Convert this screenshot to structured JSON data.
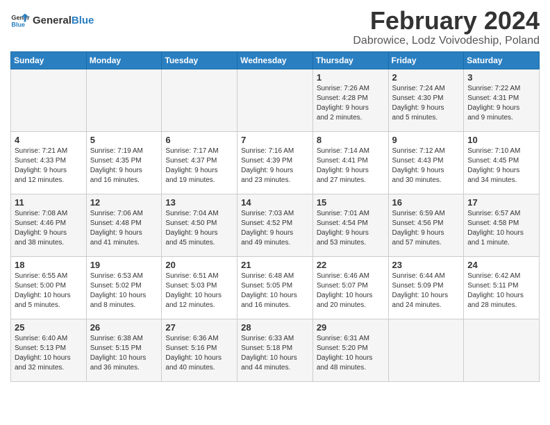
{
  "header": {
    "logo_general": "General",
    "logo_blue": "Blue",
    "title": "February 2024",
    "subtitle": "Dabrowice, Lodz Voivodeship, Poland"
  },
  "weekdays": [
    "Sunday",
    "Monday",
    "Tuesday",
    "Wednesday",
    "Thursday",
    "Friday",
    "Saturday"
  ],
  "weeks": [
    [
      {
        "day": "",
        "info": ""
      },
      {
        "day": "",
        "info": ""
      },
      {
        "day": "",
        "info": ""
      },
      {
        "day": "",
        "info": ""
      },
      {
        "day": "1",
        "info": "Sunrise: 7:26 AM\nSunset: 4:28 PM\nDaylight: 9 hours\nand 2 minutes."
      },
      {
        "day": "2",
        "info": "Sunrise: 7:24 AM\nSunset: 4:30 PM\nDaylight: 9 hours\nand 5 minutes."
      },
      {
        "day": "3",
        "info": "Sunrise: 7:22 AM\nSunset: 4:31 PM\nDaylight: 9 hours\nand 9 minutes."
      }
    ],
    [
      {
        "day": "4",
        "info": "Sunrise: 7:21 AM\nSunset: 4:33 PM\nDaylight: 9 hours\nand 12 minutes."
      },
      {
        "day": "5",
        "info": "Sunrise: 7:19 AM\nSunset: 4:35 PM\nDaylight: 9 hours\nand 16 minutes."
      },
      {
        "day": "6",
        "info": "Sunrise: 7:17 AM\nSunset: 4:37 PM\nDaylight: 9 hours\nand 19 minutes."
      },
      {
        "day": "7",
        "info": "Sunrise: 7:16 AM\nSunset: 4:39 PM\nDaylight: 9 hours\nand 23 minutes."
      },
      {
        "day": "8",
        "info": "Sunrise: 7:14 AM\nSunset: 4:41 PM\nDaylight: 9 hours\nand 27 minutes."
      },
      {
        "day": "9",
        "info": "Sunrise: 7:12 AM\nSunset: 4:43 PM\nDaylight: 9 hours\nand 30 minutes."
      },
      {
        "day": "10",
        "info": "Sunrise: 7:10 AM\nSunset: 4:45 PM\nDaylight: 9 hours\nand 34 minutes."
      }
    ],
    [
      {
        "day": "11",
        "info": "Sunrise: 7:08 AM\nSunset: 4:46 PM\nDaylight: 9 hours\nand 38 minutes."
      },
      {
        "day": "12",
        "info": "Sunrise: 7:06 AM\nSunset: 4:48 PM\nDaylight: 9 hours\nand 41 minutes."
      },
      {
        "day": "13",
        "info": "Sunrise: 7:04 AM\nSunset: 4:50 PM\nDaylight: 9 hours\nand 45 minutes."
      },
      {
        "day": "14",
        "info": "Sunrise: 7:03 AM\nSunset: 4:52 PM\nDaylight: 9 hours\nand 49 minutes."
      },
      {
        "day": "15",
        "info": "Sunrise: 7:01 AM\nSunset: 4:54 PM\nDaylight: 9 hours\nand 53 minutes."
      },
      {
        "day": "16",
        "info": "Sunrise: 6:59 AM\nSunset: 4:56 PM\nDaylight: 9 hours\nand 57 minutes."
      },
      {
        "day": "17",
        "info": "Sunrise: 6:57 AM\nSunset: 4:58 PM\nDaylight: 10 hours\nand 1 minute."
      }
    ],
    [
      {
        "day": "18",
        "info": "Sunrise: 6:55 AM\nSunset: 5:00 PM\nDaylight: 10 hours\nand 5 minutes."
      },
      {
        "day": "19",
        "info": "Sunrise: 6:53 AM\nSunset: 5:02 PM\nDaylight: 10 hours\nand 8 minutes."
      },
      {
        "day": "20",
        "info": "Sunrise: 6:51 AM\nSunset: 5:03 PM\nDaylight: 10 hours\nand 12 minutes."
      },
      {
        "day": "21",
        "info": "Sunrise: 6:48 AM\nSunset: 5:05 PM\nDaylight: 10 hours\nand 16 minutes."
      },
      {
        "day": "22",
        "info": "Sunrise: 6:46 AM\nSunset: 5:07 PM\nDaylight: 10 hours\nand 20 minutes."
      },
      {
        "day": "23",
        "info": "Sunrise: 6:44 AM\nSunset: 5:09 PM\nDaylight: 10 hours\nand 24 minutes."
      },
      {
        "day": "24",
        "info": "Sunrise: 6:42 AM\nSunset: 5:11 PM\nDaylight: 10 hours\nand 28 minutes."
      }
    ],
    [
      {
        "day": "25",
        "info": "Sunrise: 6:40 AM\nSunset: 5:13 PM\nDaylight: 10 hours\nand 32 minutes."
      },
      {
        "day": "26",
        "info": "Sunrise: 6:38 AM\nSunset: 5:15 PM\nDaylight: 10 hours\nand 36 minutes."
      },
      {
        "day": "27",
        "info": "Sunrise: 6:36 AM\nSunset: 5:16 PM\nDaylight: 10 hours\nand 40 minutes."
      },
      {
        "day": "28",
        "info": "Sunrise: 6:33 AM\nSunset: 5:18 PM\nDaylight: 10 hours\nand 44 minutes."
      },
      {
        "day": "29",
        "info": "Sunrise: 6:31 AM\nSunset: 5:20 PM\nDaylight: 10 hours\nand 48 minutes."
      },
      {
        "day": "",
        "info": ""
      },
      {
        "day": "",
        "info": ""
      }
    ]
  ]
}
